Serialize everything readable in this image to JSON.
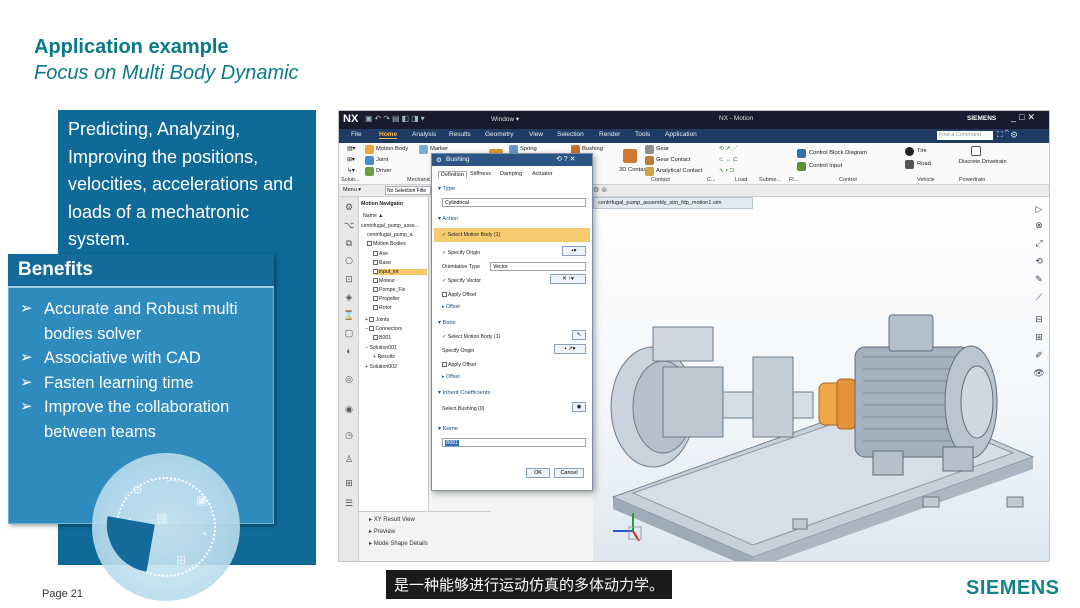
{
  "slide": {
    "title": "Application example",
    "subtitle": "Focus on Multi Body Dynamic",
    "intro": "Predicting, Analyzing, Improving the positions, velocities, accelerations and loads of a mechatronic system.",
    "benefits_title": "Benefits",
    "benefits": [
      "Accurate and Robust multi bodies solver",
      "Associative with CAD",
      "Fasten learning time",
      "Improve the collaboration between teams"
    ],
    "page": "Page 21",
    "caption": "是一种能够进行运动仿真的多体动力学。",
    "brand": "SIEMENS"
  },
  "nx": {
    "logo": "NX",
    "window_menu": "Window ▾",
    "app_title": "NX - Motion",
    "brand": "SIEMENS",
    "find_placeholder": "Find a Command",
    "tabs": [
      "File",
      "Home",
      "Analysis",
      "Results",
      "Geometry",
      "View",
      "Selection",
      "Render",
      "Tools",
      "Application"
    ],
    "ribbon": {
      "motion_body": "Motion Body",
      "joint": "Joint",
      "driver": "Driver",
      "marker": "Marker",
      "spring": "Spring",
      "bushing": "Bushing",
      "gear": "Gear",
      "gear_contact": "Gear Contact",
      "analytical_contact": "Analytical Contact",
      "contact_3d": "3D Contact",
      "control_block_diagram": "Control Block Diagram",
      "control_input": "Control Input",
      "tire": "Tire",
      "road": "Road",
      "discrete_drivetrain": "Discrete Drivetrain",
      "groups": [
        "Soluti...",
        "Mechanic",
        "Contact",
        "C...",
        "Load",
        "Subme...",
        "Fl...",
        "Control",
        "Vehicle",
        "Powertrain"
      ]
    },
    "selbar": {
      "menu": "Menu ▾",
      "filter": "No Selection Filte"
    },
    "navigator": {
      "title": "Motion Navigator",
      "column": "Name ▲",
      "rows": [
        "centrifugal_pump_asse...",
        "centrifugal_pump_a",
        "Motion Bodies",
        "Axe",
        "Base",
        "input_int",
        "Moteur",
        "Pompe_Fix",
        "Propeller",
        "Rotor",
        "Joints",
        "Connectors",
        "B001",
        "Solution001",
        "Results",
        "Solution002"
      ]
    },
    "bottom_panels": [
      "XY Result View",
      "Preview",
      "Mode Shape Details"
    ],
    "dialog": {
      "title": "Bushing",
      "controls": "⟲ ? ✕",
      "tabs": [
        "Definition",
        "Stiffness",
        "Damping",
        "Actuator"
      ],
      "type_section": "Type",
      "type_value": "Cylindrical",
      "action_section": "Action",
      "action_select": "Select Motion Body (1)",
      "action_origin": "Specify Origin",
      "orientation_label": "Orientation Type",
      "orientation_value": "Vector",
      "specify_vector": "Specify Vector",
      "apply_offset": "Apply Offset",
      "offset": "Offset",
      "base_section": "Base",
      "base_select": "Select Motion Body (1)",
      "base_origin": "Specify Origin",
      "base_apply_offset": "Apply Offset",
      "base_offset": "Offset",
      "inherit_section": "Inherit Coefficients",
      "select_bushing": "Select Bushing (0)",
      "name_section": "Name",
      "name_value": "B001",
      "ok": "OK",
      "cancel": "Cancel"
    },
    "viewport_tab": "centrifugal_pump_assembly_sim_fdp_motion1.sim"
  },
  "colors": {
    "title_teal": "#087a8c",
    "panel_blue": "#0f6a97",
    "benefit_blue": "#2f8bbd",
    "highlight_orange": "#f5cb6f"
  }
}
